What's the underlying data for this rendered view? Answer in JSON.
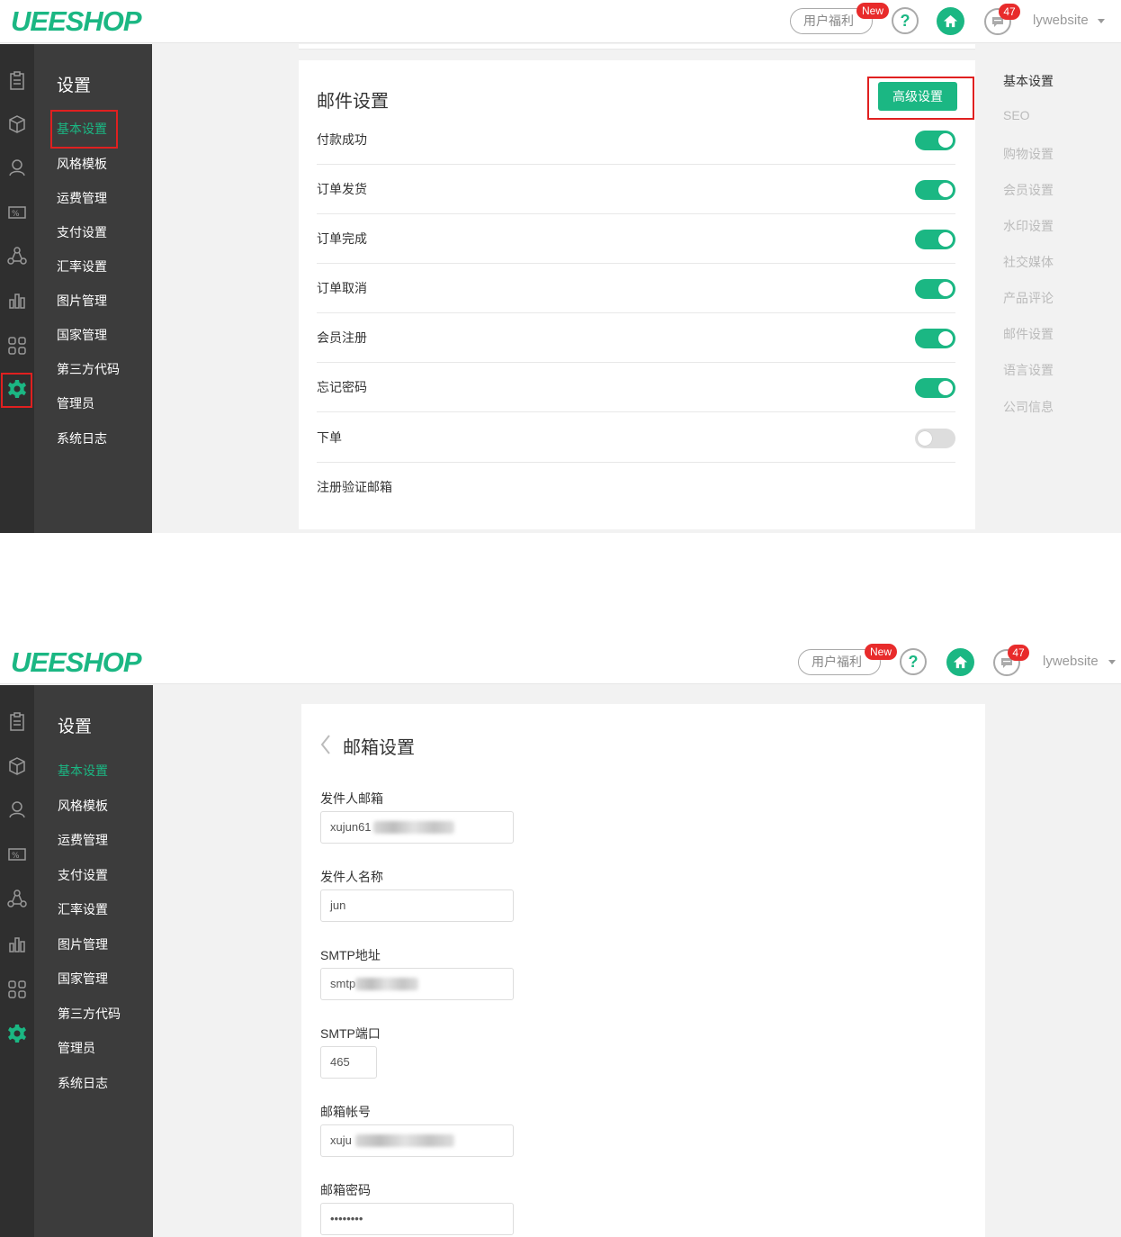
{
  "app": {
    "logo": "UEESHOP"
  },
  "header": {
    "welfare_label": "用户福利",
    "new_badge": "New",
    "help_label": "?",
    "message_count": "47",
    "username": "lywebsite"
  },
  "sidebar": {
    "title": "设置",
    "items": [
      "基本设置",
      "风格模板",
      "运费管理",
      "支付设置",
      "汇率设置",
      "图片管理",
      "国家管理",
      "第三方代码",
      "管理员",
      "系统日志"
    ],
    "active_index": 0
  },
  "mail_settings": {
    "title": "邮件设置",
    "advanced_button": "高级设置",
    "rows": [
      {
        "label": "付款成功",
        "enabled": true
      },
      {
        "label": "订单发货",
        "enabled": true
      },
      {
        "label": "订单完成",
        "enabled": true
      },
      {
        "label": "订单取消",
        "enabled": true
      },
      {
        "label": "会员注册",
        "enabled": true
      },
      {
        "label": "忘记密码",
        "enabled": true
      },
      {
        "label": "下单",
        "enabled": false
      },
      {
        "label": "注册验证邮箱",
        "enabled": null
      }
    ]
  },
  "right_nav": {
    "items": [
      "基本设置",
      "SEO",
      "购物设置",
      "会员设置",
      "水印设置",
      "社交媒体",
      "产品评论",
      "邮件设置",
      "语言设置",
      "公司信息"
    ],
    "active_index": 0
  },
  "mailbox_settings": {
    "title": "邮箱设置",
    "fields": [
      {
        "label": "发件人邮箱",
        "value": "xujun61"
      },
      {
        "label": "发件人名称",
        "value": "jun"
      },
      {
        "label": "SMTP地址",
        "value": "smtp"
      },
      {
        "label": "SMTP端口",
        "value": "465"
      },
      {
        "label": "邮箱帐号",
        "value": "xuju"
      },
      {
        "label": "邮箱密码",
        "value": "••••••••"
      }
    ]
  },
  "colors": {
    "accent": "#1bb783",
    "dark_sidebar": "#2f2f2f",
    "submenu_bg": "#3c3c3c",
    "badge_red": "#e82b2b",
    "highlight_red": "#e02020"
  }
}
